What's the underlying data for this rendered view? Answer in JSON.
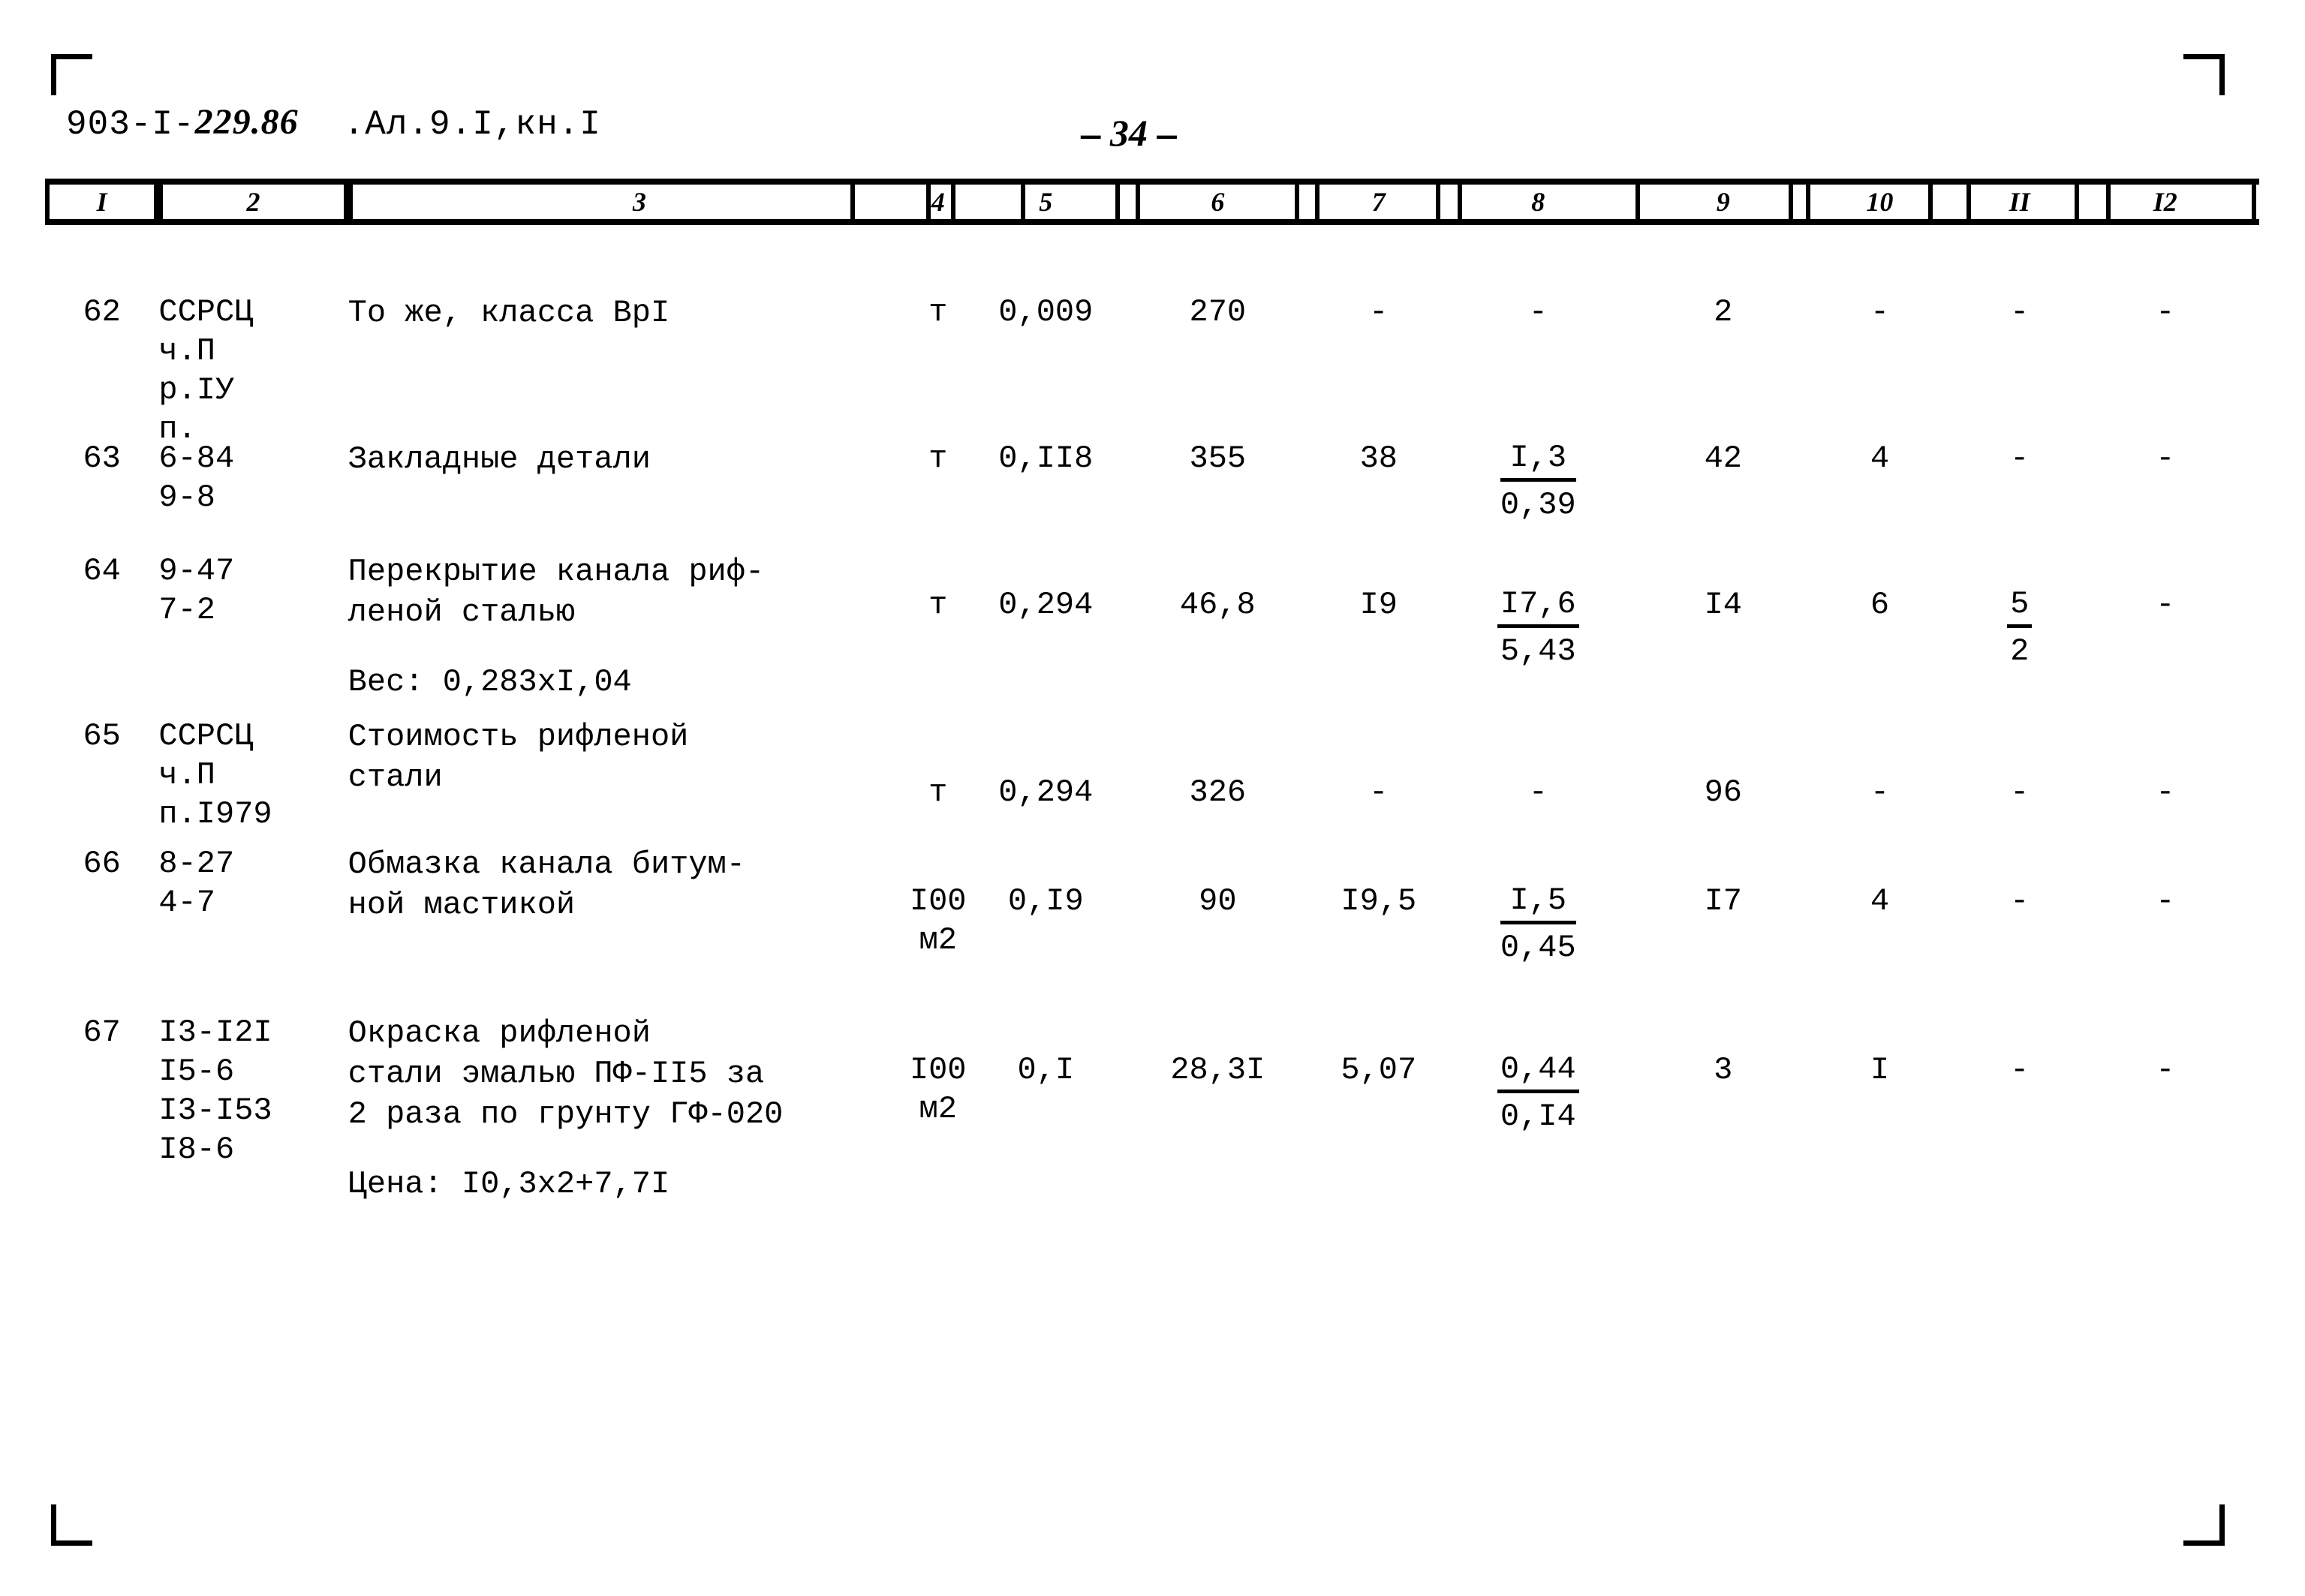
{
  "document": {
    "code_prefix": "903-I-",
    "code_hand": "229.86",
    "album": ".Ал.9.I,кн.I",
    "page_dash_left": "—",
    "page_number": "34",
    "page_dash_right": "—"
  },
  "table": {
    "column_headers": [
      "I",
      "2",
      "3",
      "4",
      "5",
      "6",
      "7",
      "8",
      "9",
      "10",
      "II",
      "I2"
    ],
    "rows": [
      {
        "no": "62",
        "code": "ССРСЦ\nч.П\nр.IУ\nп.",
        "description": "То же, класса ВрI",
        "note": "",
        "unit": "т",
        "c5": "0,009",
        "c6": "270",
        "c7": "-",
        "c8_top": "-",
        "c8_bot": "",
        "c9": "2",
        "c10": "-",
        "c11_top": "-",
        "c11_bot": "",
        "c12": "-"
      },
      {
        "no": "63",
        "code": "6-84\n9-8",
        "description": "Закладные детали",
        "note": "",
        "unit": "т",
        "c5": "0,II8",
        "c6": "355",
        "c7": "38",
        "c8_top": "I,3",
        "c8_bot": "0,39",
        "c9": "42",
        "c10": "4",
        "c11_top": "-",
        "c11_bot": "",
        "c12": "-"
      },
      {
        "no": "64",
        "code": "9-47\n7-2",
        "description": "Перекрытие канала риф-\nленой сталью",
        "note": "Вес: 0,283xI,04",
        "unit": "т",
        "c5": "0,294",
        "c6": "46,8",
        "c7": "I9",
        "c8_top": "I7,6",
        "c8_bot": "5,43",
        "c9": "I4",
        "c10": "6",
        "c11_top": "5",
        "c11_bot": "2",
        "c12": "-"
      },
      {
        "no": "65",
        "code": "ССРСЦ\nч.П\nп.I979",
        "description": "Стоимость рифленой\nстали",
        "note": "",
        "unit": "т",
        "c5": "0,294",
        "c6": "326",
        "c7": "-",
        "c8_top": "-",
        "c8_bot": "",
        "c9": "96",
        "c10": "-",
        "c11_top": "-",
        "c11_bot": "",
        "c12": "-"
      },
      {
        "no": "66",
        "code": "8-27\n4-7",
        "description": "Обмазка канала битум-\nной мастикой",
        "note": "",
        "unit": "I00\nм2",
        "c5": "0,I9",
        "c6": "90",
        "c7": "I9,5",
        "c8_top": "I,5",
        "c8_bot": "0,45",
        "c9": "I7",
        "c10": "4",
        "c11_top": "-",
        "c11_bot": "",
        "c12": "-"
      },
      {
        "no": "67",
        "code": "I3-I2I\nI5-6\nI3-I53\nI8-6",
        "description": "Окраска рифленой\nстали эмалью ПФ-II5 за\n2 раза по грунту ГФ-020",
        "note": "Цена: I0,3x2+7,7I",
        "unit": "I00\nм2",
        "c5": "0,I",
        "c6": "28,3I",
        "c7": "5,07",
        "c8_top": "0,44",
        "c8_bot": "0,I4",
        "c9": "3",
        "c10": "I",
        "c11_top": "-",
        "c11_bot": "",
        "c12": "-"
      }
    ]
  }
}
